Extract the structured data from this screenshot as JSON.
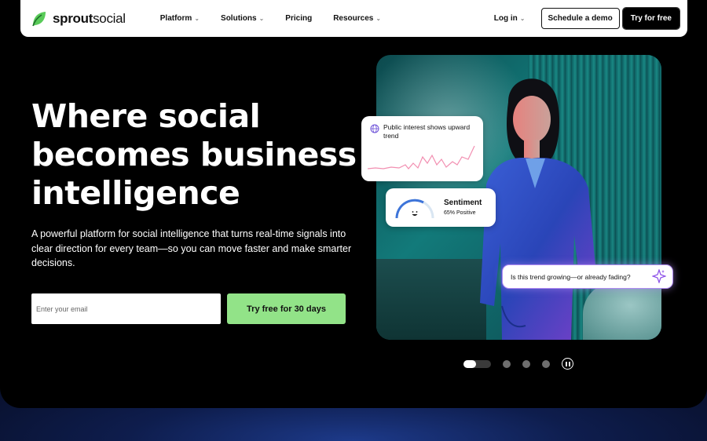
{
  "brand": {
    "name_bold": "sprout",
    "name_regular": "social",
    "accent": "#59cb59"
  },
  "nav": {
    "items": [
      {
        "label": "Platform",
        "chevron": "chevron-down-icon"
      },
      {
        "label": "Solutions",
        "chevron": "chevron-down-icon"
      },
      {
        "label": "Pricing"
      },
      {
        "label": "Resources",
        "chevron": "chevron-down-icon"
      }
    ],
    "login": "Log in",
    "demo": "Schedule a demo",
    "try": "Try for free"
  },
  "hero": {
    "headline": "Where social becomes business intelligence",
    "subtext": "A powerful platform for social intelligence that turns real-time signals into clear direction for every team—so you can move faster and make smarter decisions.",
    "email_placeholder": "Enter your email",
    "cta": "Try free for 30 days",
    "cta_color": "#92e388"
  },
  "cards": {
    "trend": {
      "title": "Public interest shows upward trend",
      "icon": "globe-icon"
    },
    "sentiment": {
      "title": "Sentiment",
      "value": "65% Positive",
      "positive_fraction": 0.65,
      "icon": "smile-icon"
    },
    "question": {
      "text": "Is this trend growing—or already fading?",
      "icon": "sparkle-icon"
    }
  },
  "carousel": {
    "slide_count": 4,
    "active_index": 0,
    "pause_icon": "pause-icon"
  }
}
